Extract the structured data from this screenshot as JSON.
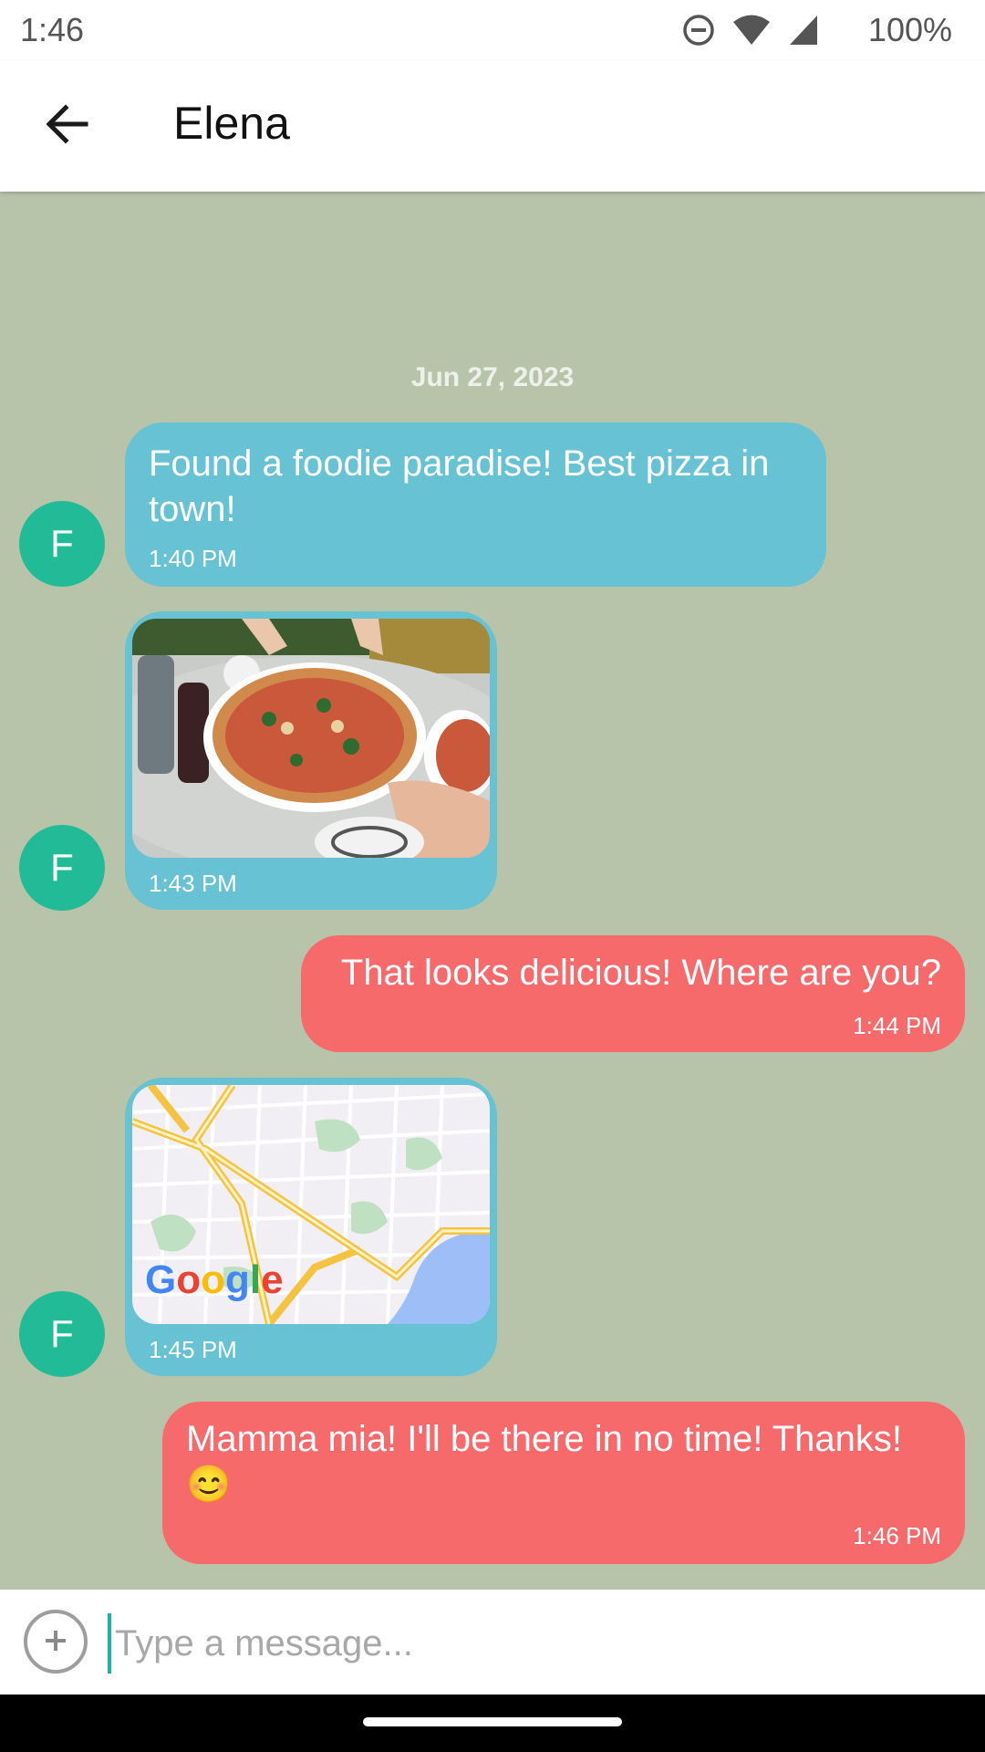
{
  "status_bar": {
    "time": "1:46",
    "battery": "100%",
    "icons": [
      "do-not-disturb-icon",
      "wifi-icon",
      "signal-icon"
    ]
  },
  "header": {
    "back_icon": "arrow-left-icon",
    "title": "Elena"
  },
  "conversation": {
    "date": "Jun 27, 2023",
    "messages": [
      {
        "direction": "incoming",
        "avatar_letter": "F",
        "type": "text",
        "text": "Found a foodie paradise! Best pizza in town!",
        "time": "1:40 PM"
      },
      {
        "direction": "incoming",
        "avatar_letter": "F",
        "type": "image",
        "content": "pizza-photo",
        "time": "1:43 PM"
      },
      {
        "direction": "outgoing",
        "type": "text",
        "text": "That looks delicious! Where are you?",
        "time": "1:44 PM"
      },
      {
        "direction": "incoming",
        "avatar_letter": "F",
        "type": "map",
        "map_logo": "Google",
        "time": "1:45 PM"
      },
      {
        "direction": "outgoing",
        "type": "text",
        "text": "Mamma mia! I'll be there in no time! Thanks! 😊",
        "time": "1:46 PM"
      }
    ]
  },
  "composer": {
    "attach_icon": "plus-circle-icon",
    "placeholder": "Type a message...",
    "value": ""
  },
  "colors": {
    "chat_background": "#b8c4aa",
    "incoming_bubble": "#67c2d4",
    "outgoing_bubble": "#f76a6c",
    "avatar": "#21bb97",
    "accent": "#1bb5a0"
  }
}
